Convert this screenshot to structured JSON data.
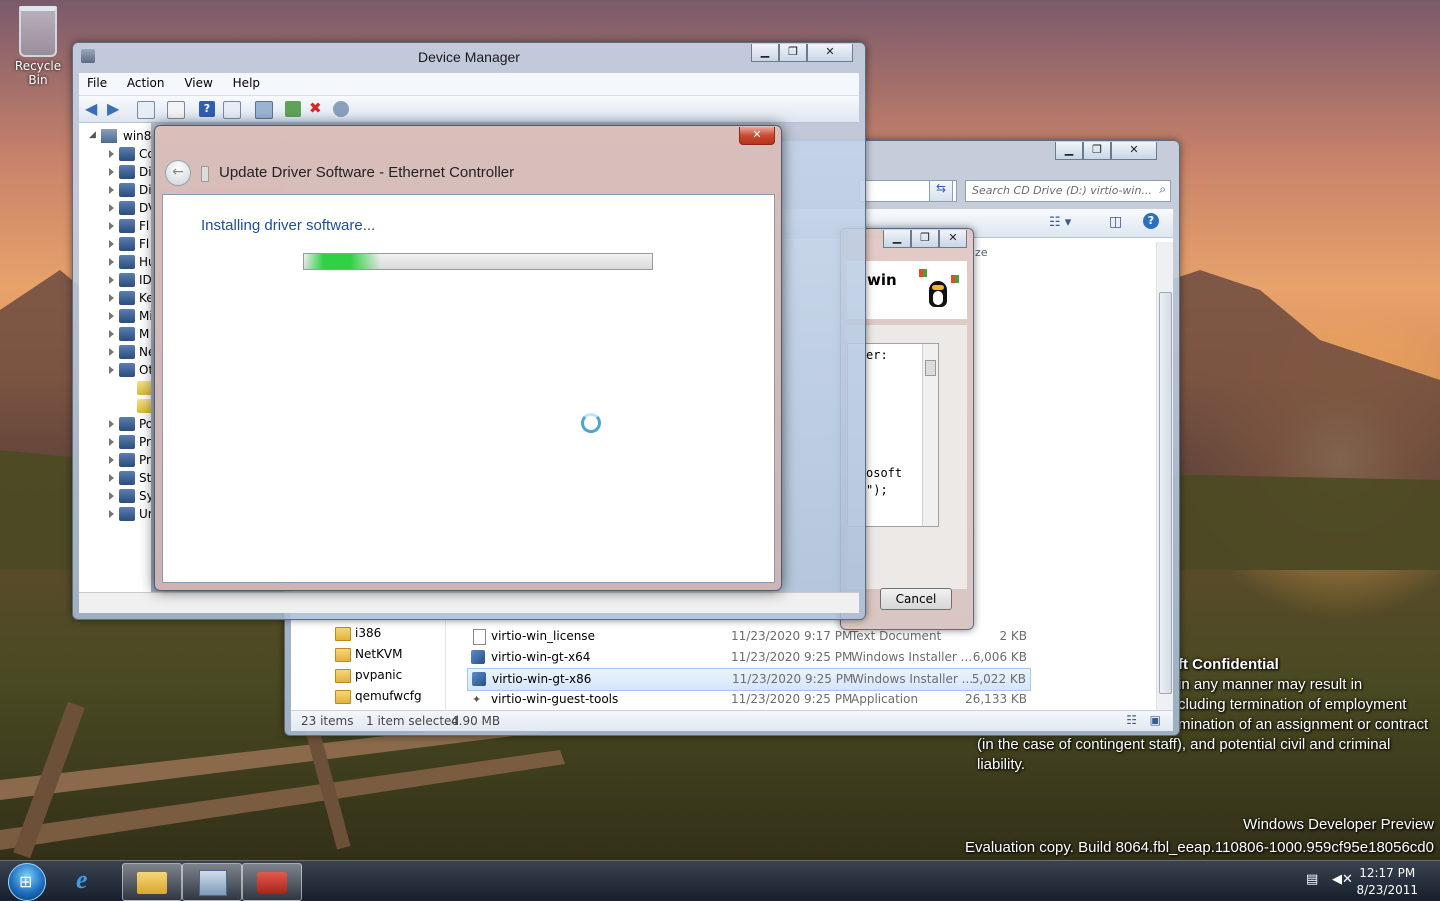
{
  "desktop": {
    "recycle_bin_label": "Recycle Bin",
    "watermark_lines": [
      "ft Confidential",
      " in any manner may result in",
      "cluding termination of employment",
      "mination of an assignment or contract",
      "(in the case of contingent staff), and potential civil and criminal",
      "liability."
    ],
    "preview_title": "Windows Developer Preview",
    "build_text": "Evaluation copy. Build 8064.fbl_eeap.110806-1000.959cf95e18056cd0"
  },
  "device_manager": {
    "title": "Device Manager",
    "menu": [
      "File",
      "Action",
      "View",
      "Help"
    ],
    "tree_root": "win80",
    "tree_items": [
      "Co",
      "Di",
      "Di",
      "DV",
      "Fl",
      "Fl",
      "Hu",
      "ID",
      "Ke",
      "Mi",
      "M",
      "Ne",
      "Ot",
      "",
      "",
      "Po",
      "Pr",
      "Pr",
      "St",
      "Sy",
      "Ur"
    ]
  },
  "wizard": {
    "title": "Update Driver Software - Ethernet Controller",
    "message": "Installing driver software...",
    "progress": 0.22,
    "close_label": "✕"
  },
  "explorer": {
    "search_placeholder": "Search CD Drive (D:) virtio-win...",
    "column_partial": "ze",
    "folders": [
      "i386",
      "NetKVM",
      "pvpanic",
      "qemufwcfg"
    ],
    "files": [
      {
        "name": "virtio-win_license",
        "date": "11/23/2020 9:17 PM",
        "type": "Text Document",
        "size": "2 KB",
        "selected": false
      },
      {
        "name": "virtio-win-gt-x64",
        "date": "11/23/2020 9:25 PM",
        "type": "Windows Installer ...",
        "size": "6,006 KB",
        "selected": false
      },
      {
        "name": "virtio-win-gt-x86",
        "date": "11/23/2020 9:25 PM",
        "type": "Windows Installer ...",
        "size": "5,022 KB",
        "selected": true
      },
      {
        "name": "virtio-win-guest-tools",
        "date": "11/23/2020 9:25 PM",
        "type": "Application",
        "size": "26,133 KB",
        "selected": false
      }
    ],
    "status_items": "23 items",
    "status_selected": "1 item selected",
    "status_size": "4.90 MB"
  },
  "installer": {
    "brand_text": "win",
    "code_lines": [
      "er:",
      "osoft",
      "\");"
    ],
    "cancel_label": "Cancel"
  },
  "taskbar": {
    "time": "12:17 PM",
    "date": "8/23/2011"
  },
  "colors": {
    "accent_link": "#1e4e9a",
    "progress_green": "#2fd145",
    "close_red": "#c94a32"
  }
}
